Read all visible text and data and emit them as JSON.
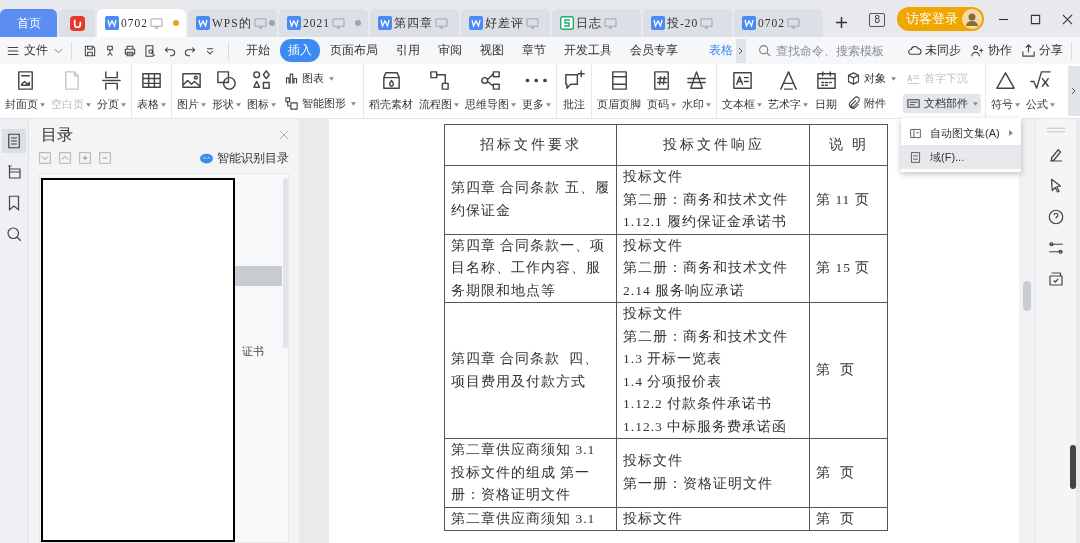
{
  "tabs": [
    {
      "kind": "home",
      "label": "首页",
      "selected": false
    },
    {
      "kind": "app",
      "selected": false
    },
    {
      "kind": "writer",
      "label": "0702",
      "selected": true,
      "dot": true,
      "modified": true
    },
    {
      "kind": "writer",
      "label": "WPS的",
      "selected": false,
      "dot": true,
      "modified": false
    },
    {
      "kind": "writer",
      "label": "2021",
      "selected": false,
      "dot": true,
      "modified": false
    },
    {
      "kind": "writer",
      "label": "第四章",
      "selected": false,
      "dot": false
    },
    {
      "kind": "writer",
      "label": "好差评",
      "selected": false,
      "dot": false
    },
    {
      "kind": "sheet",
      "label": "日志",
      "selected": false,
      "dot": false
    },
    {
      "kind": "writer",
      "label": "投-20",
      "selected": false,
      "dot": false
    },
    {
      "kind": "writer",
      "label": "0702",
      "selected": false,
      "dot": false
    }
  ],
  "tab_count": "8",
  "login_button": "访客登录",
  "menubar": {
    "file": "文件",
    "tabs": [
      {
        "label": "开始",
        "selected": false
      },
      {
        "label": "插入",
        "selected": true
      },
      {
        "label": "页面布局",
        "selected": false
      },
      {
        "label": "引用",
        "selected": false
      },
      {
        "label": "审阅",
        "selected": false
      },
      {
        "label": "视图",
        "selected": false
      },
      {
        "label": "章节",
        "selected": false
      },
      {
        "label": "开发工具",
        "selected": false
      },
      {
        "label": "会员专享",
        "selected": false
      },
      {
        "label": "表格",
        "selected": false
      }
    ],
    "search": {
      "placeholder": "查找命令、搜索模板"
    },
    "actions": [
      {
        "label": "未同步"
      },
      {
        "label": "协作"
      },
      {
        "label": "分享"
      }
    ]
  },
  "ribbon": {
    "groups": [
      {
        "items": [
          {
            "kind": "large",
            "label": "封面页",
            "dropdown": true,
            "disabled": false
          },
          {
            "kind": "large",
            "label": "空白页",
            "dropdown": true,
            "disabled": true
          },
          {
            "kind": "large",
            "label": "分页",
            "dropdown": true,
            "disabled": false
          }
        ]
      },
      {
        "items": [
          {
            "kind": "large",
            "label": "表格",
            "dropdown": true,
            "disabled": false
          }
        ]
      },
      {
        "items": [
          {
            "kind": "large",
            "label": "图片",
            "dropdown": true,
            "disabled": false
          },
          {
            "kind": "large",
            "label": "形状",
            "dropdown": true,
            "disabled": false
          },
          {
            "kind": "large",
            "label": "图标",
            "dropdown": true,
            "disabled": false
          },
          {
            "kind": "stack",
            "items": [
              {
                "label": "图表",
                "dropdown": true,
                "disabled": false
              },
              {
                "label": "智能图形",
                "dropdown": true,
                "disabled": false
              }
            ]
          }
        ]
      },
      {
        "items": [
          {
            "kind": "large",
            "label": "稻壳素材",
            "dropdown": false,
            "disabled": false
          },
          {
            "kind": "large",
            "label": "流程图",
            "dropdown": true,
            "disabled": false
          },
          {
            "kind": "large",
            "label": "思维导图",
            "dropdown": true,
            "disabled": false
          },
          {
            "kind": "large",
            "label": "更多",
            "dropdown": true,
            "disabled": false
          }
        ]
      },
      {
        "items": [
          {
            "kind": "large",
            "label": "批注",
            "dropdown": false,
            "disabled": false
          }
        ]
      },
      {
        "items": [
          {
            "kind": "large",
            "label": "页眉页脚",
            "dropdown": false,
            "disabled": false
          },
          {
            "kind": "large",
            "label": "页码",
            "dropdown": true,
            "disabled": false
          },
          {
            "kind": "large",
            "label": "水印",
            "dropdown": true,
            "disabled": false
          }
        ]
      },
      {
        "items": [
          {
            "kind": "large",
            "label": "文本框",
            "dropdown": true,
            "disabled": false
          },
          {
            "kind": "large",
            "label": "艺术字",
            "dropdown": true,
            "disabled": false
          },
          {
            "kind": "large",
            "label": "日期",
            "dropdown": false,
            "disabled": false
          },
          {
            "kind": "stack",
            "items": [
              {
                "label": "对象",
                "dropdown": true,
                "disabled": false
              },
              {
                "label": "附件",
                "dropdown": false,
                "disabled": false
              }
            ]
          },
          {
            "kind": "stack",
            "items": [
              {
                "label": "首字下沉",
                "dropdown": false,
                "disabled": true
              },
              {
                "label": "文档部件",
                "dropdown": true,
                "disabled": false,
                "expanded": true,
                "menu": [
                  {
                    "label": "自动图文集(A)",
                    "submenu": true,
                    "selected": false
                  },
                  {
                    "label": "域(F)...",
                    "submenu": false,
                    "selected": true
                  }
                ]
              }
            ]
          }
        ]
      },
      {
        "items": [
          {
            "kind": "large",
            "label": "符号",
            "dropdown": true,
            "disabled": false
          },
          {
            "kind": "large",
            "label": "公式",
            "dropdown": true,
            "disabled": false
          }
        ]
      }
    ]
  },
  "left_tools": [
    {
      "selected": true
    },
    {
      "selected": false
    },
    {
      "selected": false
    },
    {
      "selected": false
    }
  ],
  "toc_panel": {
    "title": "目录",
    "smart_button": "智能识别目录",
    "items": [
      {
        "selected": true
      },
      {
        "label": "证书",
        "selected": false
      }
    ]
  },
  "table": {
    "columns": [
      "招标文件要求",
      "投标文件响应",
      "说 明"
    ],
    "rows": [
      [
        [
          "第四章 合同条款 五、履约保证金"
        ],
        [
          "投标文件",
          "第二册：商务和技术文件",
          "1.12.1 履约保证金承诺书"
        ],
        [
          "第 11 页"
        ]
      ],
      [
        [
          "第四章 合同条款一、项目名称、工作内容、服务期限和地点等"
        ],
        [
          "投标文件",
          "第二册：商务和技术文件",
          "2.14 服务响应承诺"
        ],
        [
          "第 15 页"
        ]
      ],
      [
        [
          "第四章 合同条款  四、项目费用及付款方式"
        ],
        [
          "投标文件",
          "第二册：商务和技术文件",
          "1.3 开标一览表",
          "1.4 分项报价表",
          "1.12.2 付款条件承诺书",
          "1.12.3 中标服务费承诺函"
        ],
        [
          "第  页"
        ]
      ],
      [
        [
          "第二章供应商须知 3.1 投标文件的组成 第一册：资格证明文件"
        ],
        [
          "投标文件",
          "第一册：资格证明文件"
        ],
        [
          "第  页"
        ]
      ],
      [
        [
          "第二章供应商须知 3.1"
        ],
        [
          "投标文件"
        ],
        [
          "第  页"
        ]
      ]
    ]
  }
}
